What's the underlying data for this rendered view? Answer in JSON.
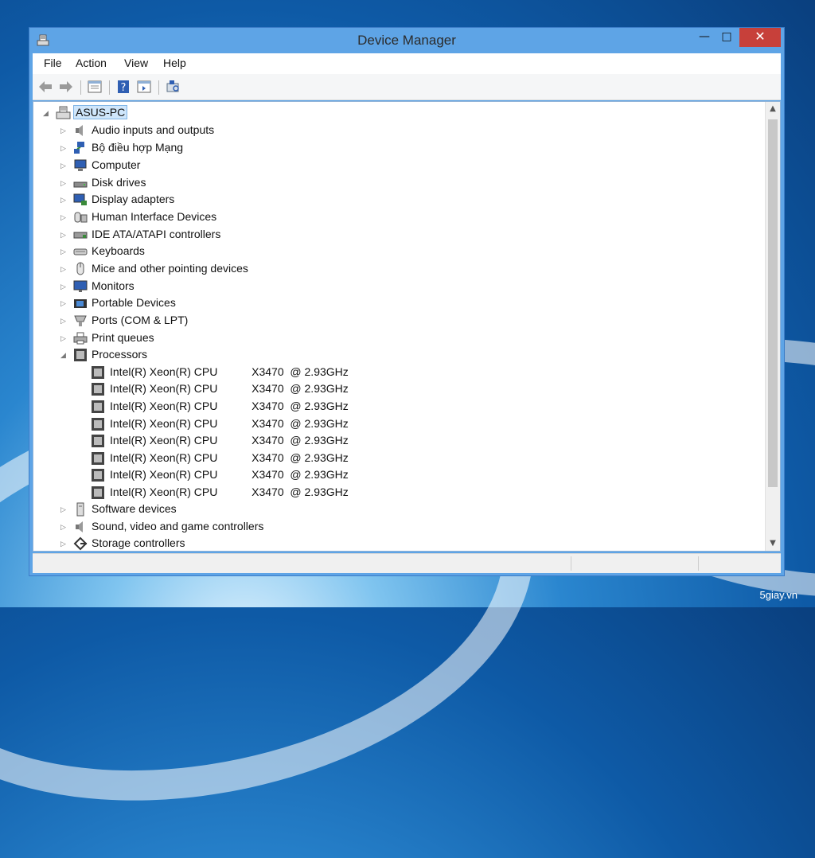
{
  "window": {
    "title": "Device Manager"
  },
  "menu": [
    "File",
    "Action",
    "View",
    "Help"
  ],
  "tree": {
    "root": "ASUS-PC",
    "categories": [
      {
        "label": "Audio inputs and outputs",
        "icon": "speaker-icon"
      },
      {
        "label": "Bộ điều hợp Mạng",
        "icon": "network-icon"
      },
      {
        "label": "Computer",
        "icon": "computer-icon"
      },
      {
        "label": "Disk drives",
        "icon": "disk-icon"
      },
      {
        "label": "Display adapters",
        "icon": "display-icon"
      },
      {
        "label": "Human Interface Devices",
        "icon": "hid-icon"
      },
      {
        "label": "IDE ATA/ATAPI controllers",
        "icon": "ide-icon"
      },
      {
        "label": "Keyboards",
        "icon": "keyboard-icon"
      },
      {
        "label": "Mice and other pointing devices",
        "icon": "mouse-icon"
      },
      {
        "label": "Monitors",
        "icon": "monitor-icon"
      },
      {
        "label": "Portable Devices",
        "icon": "portable-icon"
      },
      {
        "label": "Ports (COM & LPT)",
        "icon": "port-icon"
      },
      {
        "label": "Print queues",
        "icon": "printer-icon"
      },
      {
        "label": "Processors",
        "icon": "cpu-icon",
        "expanded": true
      }
    ],
    "processors": [
      "Intel(R) Xeon(R) CPU           X3470  @ 2.93GHz",
      "Intel(R) Xeon(R) CPU           X3470  @ 2.93GHz",
      "Intel(R) Xeon(R) CPU           X3470  @ 2.93GHz",
      "Intel(R) Xeon(R) CPU           X3470  @ 2.93GHz",
      "Intel(R) Xeon(R) CPU           X3470  @ 2.93GHz",
      "Intel(R) Xeon(R) CPU           X3470  @ 2.93GHz",
      "Intel(R) Xeon(R) CPU           X3470  @ 2.93GHz",
      "Intel(R) Xeon(R) CPU           X3470  @ 2.93GHz"
    ],
    "after": [
      {
        "label": "Software devices",
        "icon": "software-icon"
      },
      {
        "label": "Sound, video and game controllers",
        "icon": "speaker-icon"
      },
      {
        "label": "Storage controllers",
        "icon": "storage-icon"
      }
    ]
  },
  "watermark": "5giay.vn",
  "colors": {
    "titlebar": "#5ea4e6",
    "close": "#c7403a",
    "selection": "#cfe6fb"
  }
}
